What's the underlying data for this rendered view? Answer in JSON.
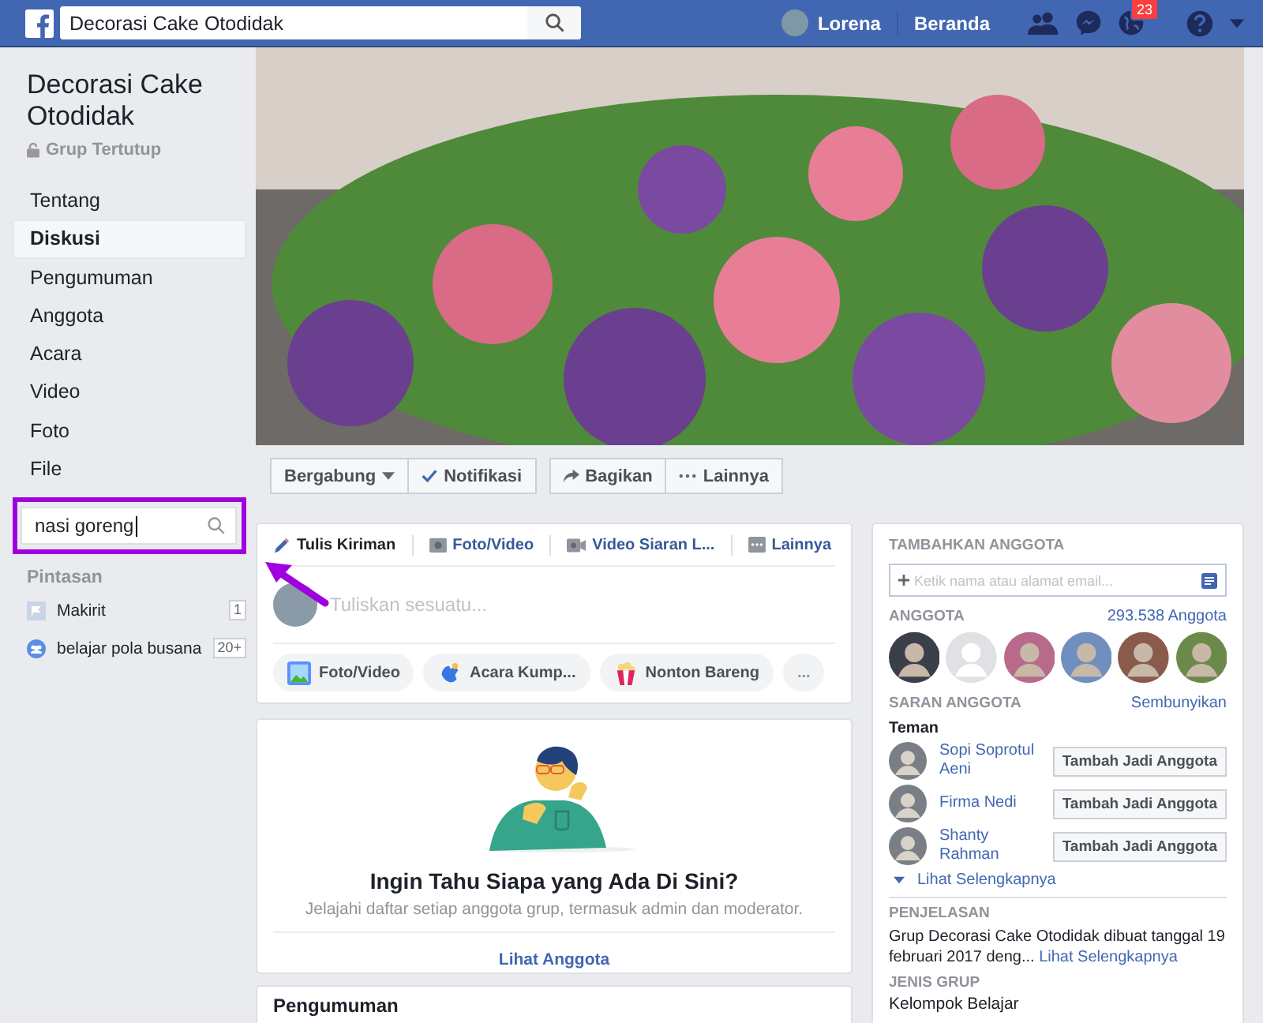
{
  "topbar": {
    "search_value": "Decorasi Cake Otodidak",
    "user_name": "Lorena",
    "home_label": "Beranda",
    "notification_count": "23"
  },
  "sidebar": {
    "group_name": "Decorasi Cake Otodidak",
    "privacy": "Grup Tertutup",
    "nav": [
      {
        "label": "Tentang",
        "selected": false
      },
      {
        "label": "Diskusi",
        "selected": true
      },
      {
        "label": "Pengumuman",
        "selected": false
      },
      {
        "label": "Anggota",
        "selected": false
      },
      {
        "label": "Acara",
        "selected": false
      },
      {
        "label": "Video",
        "selected": false
      },
      {
        "label": "Foto",
        "selected": false
      },
      {
        "label": "File",
        "selected": false
      }
    ],
    "search_value": "nasi goreng",
    "shortcuts_title": "Pintasan",
    "shortcuts": [
      {
        "kind": "page",
        "label": "Makirit",
        "badge": "1"
      },
      {
        "kind": "group",
        "label": "belajar pola busana",
        "badge": "20+"
      }
    ]
  },
  "actions": [
    {
      "kind": "dropdown",
      "label": "Bergabung"
    },
    {
      "kind": "check",
      "label": "Notifikasi"
    },
    {
      "kind": "share",
      "label": "Bagikan"
    },
    {
      "kind": "more",
      "label": "Lainnya"
    }
  ],
  "composer": {
    "tabs": [
      {
        "kind": "write",
        "label": "Tulis Kiriman",
        "selected": true
      },
      {
        "kind": "photo",
        "label": "Foto/Video",
        "selected": false
      },
      {
        "kind": "live",
        "label": "Video Siaran L...",
        "selected": false
      },
      {
        "kind": "more",
        "label": "Lainnya",
        "selected": false
      }
    ],
    "placeholder": "Tuliskan sesuatu...",
    "chips": [
      {
        "kind": "photo",
        "label": "Foto/Video"
      },
      {
        "kind": "event",
        "label": "Acara Kump..."
      },
      {
        "kind": "watch",
        "label": "Nonton Bareng"
      },
      {
        "kind": "more",
        "label": "..."
      }
    ]
  },
  "members_promo": {
    "title": "Ingin Tahu Siapa yang Ada Di Sini?",
    "subtitle": "Jelajahi daftar setiap anggota grup, termasuk admin dan moderator.",
    "link": "Lihat Anggota"
  },
  "announcements": {
    "title": "Pengumuman"
  },
  "right": {
    "add_title": "TAMBAHKAN ANGGOTA",
    "add_placeholder": "Ketik nama atau alamat email...",
    "members_title": "ANGGOTA",
    "members_count": "293.538 Anggota",
    "suggest_title": "SARAN ANGGOTA",
    "hide_link": "Sembunyikan",
    "friends_label": "Teman",
    "suggestions": [
      {
        "name": "Sopi Soprotul Aeni",
        "button": "Tambah Jadi Anggota"
      },
      {
        "name": "Firma Nedi",
        "button": "Tambah Jadi Anggota"
      },
      {
        "name": "Shanty Rahman",
        "button": "Tambah Jadi Anggota"
      }
    ],
    "see_more": "Lihat Selengkapnya",
    "desc_title": "PENJELASAN",
    "desc_text": "Grup Decorasi Cake Otodidak dibuat tanggal 19 februari 2017 deng...",
    "desc_link": "Lihat Selengkapnya",
    "type_title": "JENIS GRUP",
    "type_value": "Kelompok Belajar"
  }
}
